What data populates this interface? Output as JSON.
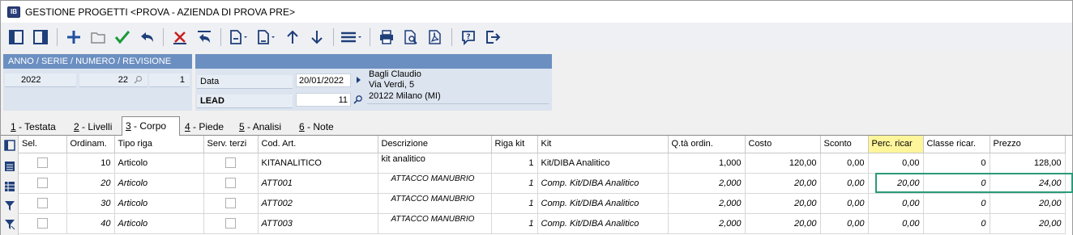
{
  "window": {
    "title": "GESTIONE PROGETTI <PROVA - AZIENDA DI PROVA PRE>",
    "app_icon_text": "IB"
  },
  "toolbar": {
    "icons": [
      "panel-left-icon",
      "panel-right-icon",
      "add-icon",
      "open-folder-icon",
      "confirm-icon",
      "undo-icon",
      "delete-icon",
      "revert-icon",
      "document-new-icon",
      "document-icon",
      "arrow-up-icon",
      "arrow-down-icon",
      "menu-icon",
      "print-icon",
      "print-preview-icon",
      "pdf-icon",
      "help-icon",
      "exit-icon"
    ]
  },
  "header": {
    "left_title": "ANNO / SERIE / NUMERO / REVISIONE",
    "anno": "2022",
    "numero": "22",
    "revisione": "1",
    "data_label": "Data",
    "data_value": "20/01/2022",
    "lead_label": "LEAD",
    "lead_value": "11",
    "address": {
      "name": "Bagli Claudio",
      "street": "Via Verdi, 5",
      "city": "20122 Milano (MI)"
    }
  },
  "tabs": [
    {
      "num": "1",
      "label": " - Testata"
    },
    {
      "num": "2",
      "label": " - Livelli"
    },
    {
      "num": "3",
      "label": " - Corpo"
    },
    {
      "num": "4",
      "label": " - Piede"
    },
    {
      "num": "5",
      "label": " - Analisi"
    },
    {
      "num": "6",
      "label": " - Note"
    }
  ],
  "grid": {
    "columns": [
      "Sel.",
      "Ordinam.",
      "Tipo riga",
      "Serv. terzi",
      "Cod. Art.",
      "Descrizione",
      "Riga kit",
      "Kit",
      "Q.tà ordin.",
      "Costo",
      "Sconto",
      "Perc. ricar",
      "Classe ricar.",
      "Prezzo"
    ],
    "rows": [
      {
        "ord": "10",
        "tipo": "Articolo",
        "cod": "KITANALITICO",
        "desc": "kit analitico",
        "riga_kit": "1",
        "kit": "Kit/DIBA Analitico",
        "qta": "1,000",
        "costo": "120,00",
        "sconto": "0,00",
        "perc": "0,00",
        "classe": "0",
        "prezzo": "128,00"
      },
      {
        "ord": "20",
        "tipo": "Articolo",
        "cod": "ATT001",
        "desc": "ATTACCO MANUBRIO",
        "riga_kit": "1",
        "kit": "Comp. Kit/DIBA Analitico",
        "qta": "2,000",
        "costo": "20,00",
        "sconto": "0,00",
        "perc": "20,00",
        "classe": "0",
        "prezzo": "24,00"
      },
      {
        "ord": "30",
        "tipo": "Articolo",
        "cod": "ATT002",
        "desc": "ATTACCO MANUBRIO",
        "riga_kit": "1",
        "kit": "Comp. Kit/DIBA Analitico",
        "qta": "2,000",
        "costo": "20,00",
        "sconto": "0,00",
        "perc": "0,00",
        "classe": "0",
        "prezzo": "20,00"
      },
      {
        "ord": "40",
        "tipo": "Articolo",
        "cod": "ATT003",
        "desc": "ATTACCO MANUBRIO",
        "riga_kit": "1",
        "kit": "Comp. Kit/DIBA Analitico",
        "qta": "2,000",
        "costo": "20,00",
        "sconto": "0,00",
        "perc": "0,00",
        "classe": "0",
        "prezzo": "20,00"
      }
    ]
  },
  "colors": {
    "header_blue": "#6b8fc1",
    "highlight_col": "#fff59a",
    "highlight_box": "#2a9a78"
  }
}
